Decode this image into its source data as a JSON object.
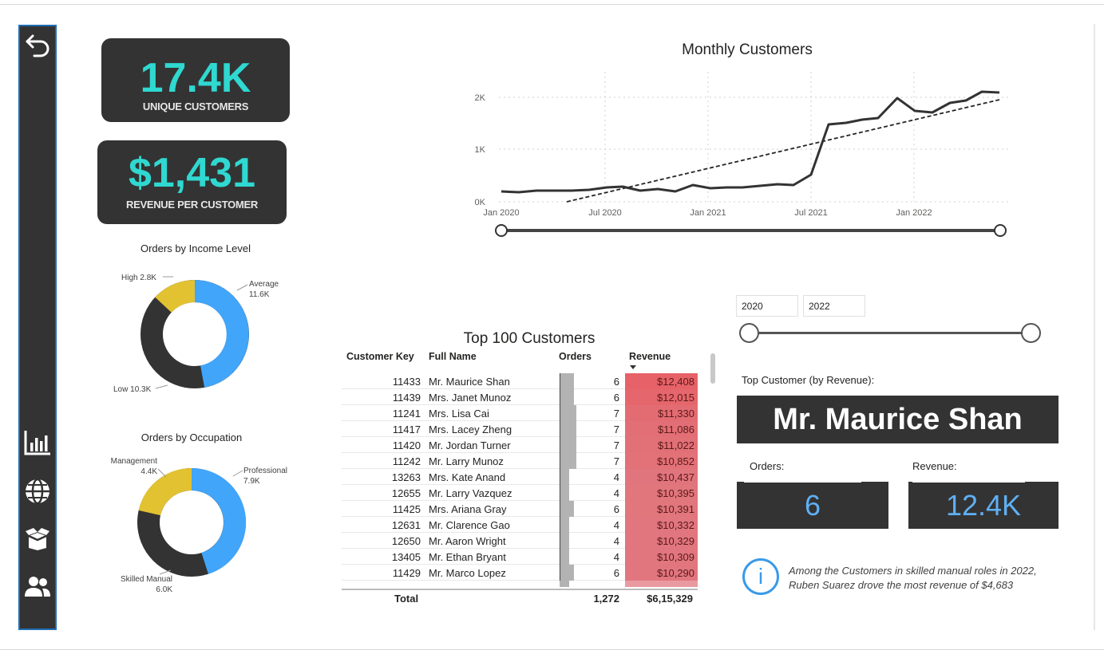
{
  "sidebar": {
    "icons": [
      "back-arrow-icon",
      "bar-chart-icon",
      "globe-icon",
      "box-icon",
      "users-icon"
    ]
  },
  "kpis": [
    {
      "value": "17.4K",
      "label": "UNIQUE CUSTOMERS"
    },
    {
      "value": "$1,431",
      "label": "REVENUE PER CUSTOMER"
    }
  ],
  "monthly_chart": {
    "title": "Monthly Customers",
    "x_ticks": [
      "Jan 2020",
      "Jul 2020",
      "Jan 2021",
      "Jul 2021",
      "Jan 2022"
    ],
    "y_ticks": [
      "0K",
      "1K",
      "2K"
    ]
  },
  "donut_income": {
    "title": "Orders by Income Level",
    "labels": [
      {
        "name": "High",
        "value": "2.8K"
      },
      {
        "name": "Average",
        "value": "11.6K"
      },
      {
        "name": "Low",
        "value": "10.3K"
      }
    ]
  },
  "donut_occupation": {
    "title": "Orders by Occupation",
    "labels": [
      {
        "name": "Management",
        "value": "4.4K"
      },
      {
        "name": "Professional",
        "value": "7.9K"
      },
      {
        "name": "Skilled Manual",
        "value": "6.0K"
      }
    ]
  },
  "table": {
    "title": "Top 100 Customers",
    "headers": {
      "key": "Customer Key",
      "name": "Full Name",
      "orders": "Orders",
      "revenue": "Revenue"
    },
    "rows": [
      {
        "key": "11433",
        "name": "Mr. Maurice Shan",
        "orders": "6",
        "revenue": "$12,408"
      },
      {
        "key": "11439",
        "name": "Mrs. Janet Munoz",
        "orders": "6",
        "revenue": "$12,015"
      },
      {
        "key": "11241",
        "name": "Mrs. Lisa Cai",
        "orders": "7",
        "revenue": "$11,330"
      },
      {
        "key": "11417",
        "name": "Mrs. Lacey Zheng",
        "orders": "7",
        "revenue": "$11,086"
      },
      {
        "key": "11420",
        "name": "Mr. Jordan Turner",
        "orders": "7",
        "revenue": "$11,022"
      },
      {
        "key": "11242",
        "name": "Mr. Larry Munoz",
        "orders": "7",
        "revenue": "$10,852"
      },
      {
        "key": "13263",
        "name": "Mrs. Kate Anand",
        "orders": "4",
        "revenue": "$10,437"
      },
      {
        "key": "12655",
        "name": "Mr. Larry Vazquez",
        "orders": "4",
        "revenue": "$10,395"
      },
      {
        "key": "11425",
        "name": "Mrs. Ariana Gray",
        "orders": "6",
        "revenue": "$10,391"
      },
      {
        "key": "12631",
        "name": "Mr. Clarence Gao",
        "orders": "4",
        "revenue": "$10,332"
      },
      {
        "key": "12650",
        "name": "Mr. Aaron Wright",
        "orders": "4",
        "revenue": "$10,329"
      },
      {
        "key": "13405",
        "name": "Mr. Ethan Bryant",
        "orders": "4",
        "revenue": "$10,309"
      },
      {
        "key": "11429",
        "name": "Mr. Marco Lopez",
        "orders": "6",
        "revenue": "$10,290"
      }
    ],
    "total": {
      "label": "Total",
      "orders": "1,272",
      "revenue": "$6,15,329"
    }
  },
  "filters": {
    "start_year": "2020",
    "end_year": "2022"
  },
  "top_customer": {
    "label": "Top Customer (by Revenue):",
    "name": "Mr. Maurice Shan",
    "orders_label": "Orders:",
    "orders_value": "6",
    "revenue_label": "Revenue:",
    "revenue_value": "12.4K"
  },
  "insight": {
    "line1": "Among the Customers in skilled manual roles in 2022,",
    "line2": "Ruben Suarez drove the most revenue of $4,683"
  },
  "colors": {
    "accent": "#2fd8d0",
    "blue": "#41a5fa",
    "yellow": "#e2c230",
    "dark": "#333333",
    "revenue_bar": "#e06c75"
  }
}
